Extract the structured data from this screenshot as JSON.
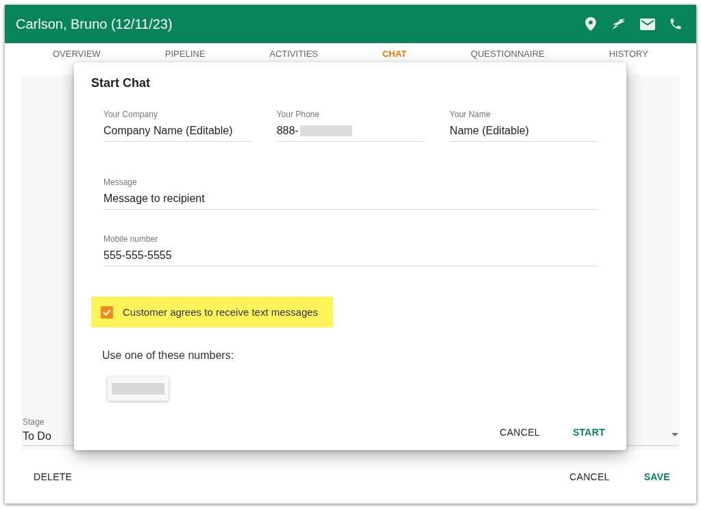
{
  "window": {
    "title": "Carlson, Bruno (12/11/23)"
  },
  "tabs": [
    {
      "label": "OVERVIEW",
      "selected": false
    },
    {
      "label": "PIPELINE",
      "selected": false
    },
    {
      "label": "ACTIVITIES",
      "selected": false
    },
    {
      "label": "CHAT",
      "selected": true
    },
    {
      "label": "QUESTIONNAIRE",
      "selected": false
    },
    {
      "label": "HISTORY",
      "selected": false
    }
  ],
  "stage_field": {
    "label": "Stage",
    "value": "To Do"
  },
  "footer": {
    "left_buttons": [
      {
        "label": "DELETE"
      }
    ],
    "right_buttons": [
      {
        "label": "CANCEL",
        "kind": "plain"
      },
      {
        "label": "SAVE",
        "kind": "primary"
      }
    ]
  },
  "dialog": {
    "title": "Start Chat",
    "fields": [
      {
        "label": "Your Company",
        "value": "Company Name (Editable)",
        "kind": "third",
        "redacted": false
      },
      {
        "label": "Your Phone",
        "value": "888-",
        "kind": "third",
        "redacted": true
      },
      {
        "label": "Your Name",
        "value": "Name (Editable)",
        "kind": "third",
        "redacted": false
      },
      {
        "label": "Message",
        "value": "Message to recipient",
        "kind": "full",
        "redacted": false
      },
      {
        "label": "Mobile number",
        "value": "555-555-5555",
        "kind": "full",
        "redacted": false
      }
    ],
    "consent": {
      "label": "Customer agrees to receive text messages",
      "checked": true,
      "highlighted": true
    },
    "numbers_label": "Use one of these numbers:",
    "number_options": [
      {
        "kind": "redacted"
      }
    ],
    "buttons": [
      {
        "label": "CANCEL",
        "kind": "plain"
      },
      {
        "label": "START",
        "kind": "primary"
      }
    ]
  }
}
